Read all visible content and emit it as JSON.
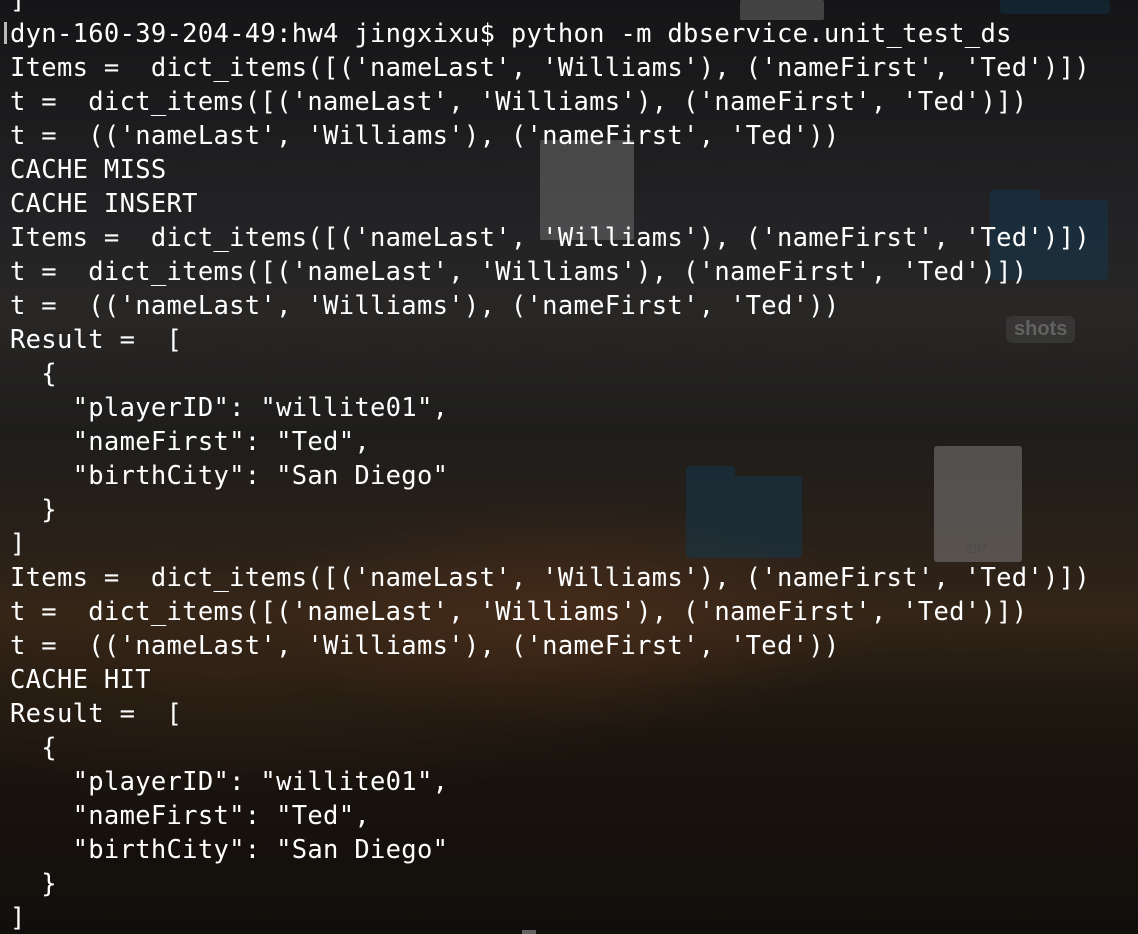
{
  "terminal": {
    "lines": [
      "]",
      "dyn-160-39-204-49:hw4 jingxixu$ python -m dbservice.unit_test_ds",
      "Items =  dict_items([('nameLast', 'Williams'), ('nameFirst', 'Ted')])",
      "t =  dict_items([('nameLast', 'Williams'), ('nameFirst', 'Ted')])",
      "t =  (('nameLast', 'Williams'), ('nameFirst', 'Ted'))",
      "CACHE MISS",
      "CACHE INSERT",
      "Items =  dict_items([('nameLast', 'Williams'), ('nameFirst', 'Ted')])",
      "t =  dict_items([('nameLast', 'Williams'), ('nameFirst', 'Ted')])",
      "t =  (('nameLast', 'Williams'), ('nameFirst', 'Ted'))",
      "Result =  [",
      "  {",
      "    \"playerID\": \"willite01\",",
      "    \"nameFirst\": \"Ted\",",
      "    \"birthCity\": \"San Diego\"",
      "  }",
      "]",
      "Items =  dict_items([('nameLast', 'Williams'), ('nameFirst', 'Ted')])",
      "t =  dict_items([('nameLast', 'Williams'), ('nameFirst', 'Ted')])",
      "t =  (('nameLast', 'Williams'), ('nameFirst', 'Ted'))",
      "CACHE HIT",
      "Result =  [",
      "  {",
      "    \"playerID\": \"willite01\",",
      "    \"nameFirst\": \"Ted\",",
      "    \"birthCity\": \"San Diego\"",
      "  }",
      "]"
    ]
  },
  "desktop": {
    "zip_label": "ZIP",
    "shots_label": "shots"
  },
  "colors": {
    "terminal_text": "#ffffff",
    "folder": "#1d4e6e"
  }
}
